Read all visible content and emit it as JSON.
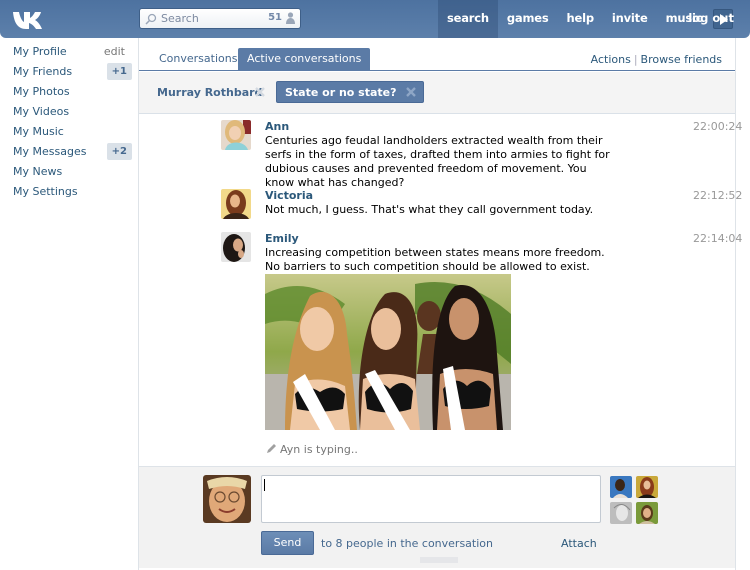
{
  "header": {
    "logo": "vk-logo",
    "search": {
      "placeholder": "Search",
      "value": "",
      "online_count": "51"
    },
    "nav": [
      {
        "label": "search",
        "active": true
      },
      {
        "label": "games",
        "active": false
      },
      {
        "label": "help",
        "active": false
      },
      {
        "label": "invite",
        "active": false
      },
      {
        "label": "music",
        "active": false
      }
    ],
    "player_icon": "play-icon",
    "logout_label": "log out"
  },
  "sidebar": {
    "items": [
      {
        "label": "My Profile",
        "extra": "edit"
      },
      {
        "label": "My Friends",
        "badge": "+1"
      },
      {
        "label": "My Photos"
      },
      {
        "label": "My Videos"
      },
      {
        "label": "My Music"
      },
      {
        "label": "My Messages",
        "badge": "+2"
      },
      {
        "label": "My News"
      },
      {
        "label": "My Settings"
      }
    ]
  },
  "main": {
    "tabs": [
      {
        "label": "Conversations",
        "active": false
      },
      {
        "label": "Active conversations",
        "active": true
      }
    ],
    "actions": {
      "actions_label": "Actions",
      "separator": "|",
      "browse_label": "Browse friends"
    },
    "participant": "Murray Rothbard",
    "topic": "State or no state?"
  },
  "messages": [
    {
      "author": "Ann",
      "time": "22:00:24",
      "text": "Centuries ago feudal landholders extracted wealth from their serfs in the form of taxes, drafted them into armies to fight for dubious causes and prevented freedom of movement. You know what has changed?"
    },
    {
      "author": "Victoria",
      "time": "22:12:52",
      "text": "Not much, I guess. That's what they call government today."
    },
    {
      "author": "Emily",
      "time": "22:14:04",
      "text": "Increasing competition between states means more freedom.\nNo barriers to such competition should be allowed to exist.",
      "attachment": "photo"
    }
  ],
  "typing": "Ayn is typing..",
  "composer": {
    "value": "",
    "send_label": "Send",
    "recipients_note": "to 8 people in the conversation",
    "attach_label": "Attach"
  },
  "colors": {
    "header": "#5b7ba6",
    "link": "#2b587a",
    "accent": "#5b7ba6",
    "panel_bg": "#f4f4f4"
  }
}
